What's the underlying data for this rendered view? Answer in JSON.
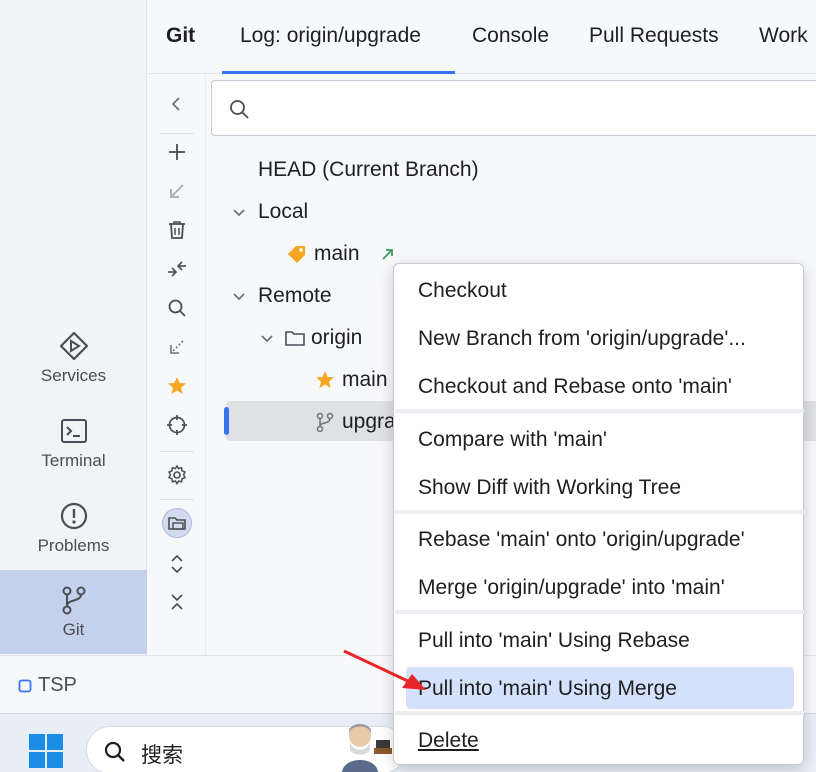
{
  "left_strip": [
    {
      "id": "services",
      "label": "Services"
    },
    {
      "id": "terminal",
      "label": "Terminal"
    },
    {
      "id": "problems",
      "label": "Problems"
    },
    {
      "id": "git",
      "label": "Git"
    }
  ],
  "tabbar": {
    "title": "Git",
    "tabs": [
      "Log: origin/upgrade",
      "Console",
      "Pull Requests",
      "Work"
    ]
  },
  "search": {
    "value": "",
    "placeholder": ""
  },
  "tree": {
    "head": "HEAD (Current Branch)",
    "local": "Local",
    "local_main": "main",
    "remote": "Remote",
    "origin": "origin",
    "origin_main": "main",
    "origin_upgrade": "upgra"
  },
  "menu": {
    "items": [
      "Checkout",
      "New Branch from 'origin/upgrade'...",
      "Checkout and Rebase onto 'main'",
      "Compare with 'main'",
      "Show Diff with Working Tree",
      "Rebase 'main' onto 'origin/upgrade'",
      "Merge 'origin/upgrade' into 'main'",
      "Pull into 'main' Using Rebase",
      "Pull into 'main' Using Merge",
      "Delete"
    ]
  },
  "status": {
    "project": "TSP"
  },
  "taskbar": {
    "search_text": "搜索"
  },
  "colors": {
    "accent": "#3574f0",
    "favorite": "#f5a623",
    "tag": "#f5a623",
    "incoming": "#3c9a5f",
    "pointer_arrow": "#e8262a"
  }
}
